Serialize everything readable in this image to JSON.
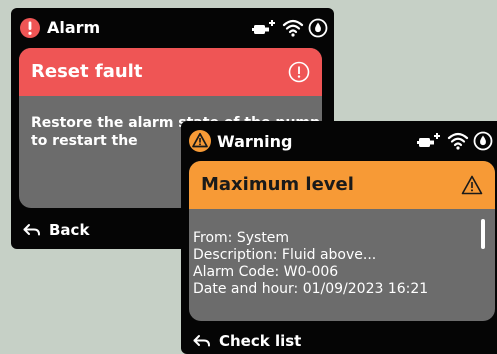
{
  "alarm_screen": {
    "title": "Alarm",
    "title_icon": "exclamation-circle-icon",
    "status_icons": [
      "plug-icon",
      "wifi-icon",
      "water-drop-icon"
    ],
    "card": {
      "heading": "Reset fault",
      "heading_icon": "info-circle-icon",
      "message": "Restore the alarm state of the pump to restart the"
    },
    "back_label": "Back",
    "colors": {
      "header": "#ef5555",
      "card": "#6c6c6c"
    }
  },
  "warning_screen": {
    "title": "Warning",
    "title_icon": "warning-triangle-icon",
    "status_icons": [
      "plug-icon",
      "wifi-icon",
      "water-drop-icon"
    ],
    "card": {
      "heading": "Maximum level",
      "heading_icon": "warning-triangle-icon",
      "details": [
        "From: System",
        "Description: Fluid above...",
        "Alarm Code: W0-006",
        "Date and hour: 01/09/2023 16:21"
      ]
    },
    "check_list_label": "Check list",
    "colors": {
      "header": "#f79a36",
      "card": "#6c6c6c"
    }
  }
}
